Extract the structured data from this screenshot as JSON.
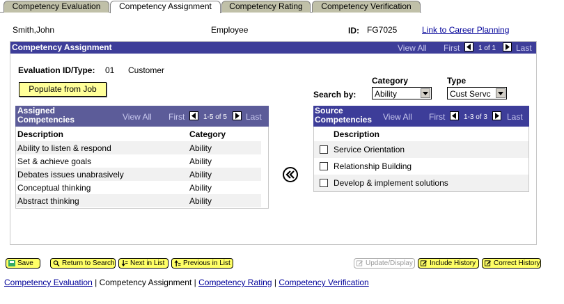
{
  "tabs": [
    {
      "label": "Competency Evaluation",
      "active": false
    },
    {
      "label": "Competency Assignment",
      "active": true
    },
    {
      "label": "Competency Rating",
      "active": false
    },
    {
      "label": "Competency Verification",
      "active": false
    }
  ],
  "header": {
    "name": "Smith,John",
    "role": "Employee",
    "id_label": "ID:",
    "id_value": "FG7025",
    "career_link": "Link to Career Planning"
  },
  "panel": {
    "title": "Competency Assignment",
    "view_all": "View All",
    "first": "First",
    "count": "1 of 1",
    "last": "Last"
  },
  "evaluation": {
    "label": "Evaluation ID/Type:",
    "id": "01",
    "type": "Customer"
  },
  "populate_button": "Populate from Job",
  "search": {
    "label": "Search by:",
    "category_label": "Category",
    "category_value": "Ability",
    "type_label": "Type",
    "type_value": "Cust Servc"
  },
  "assigned": {
    "title_line1": "Assigned",
    "title_line2": "Competencies",
    "view_all": "View All",
    "first": "First",
    "count": "1-5 of 5",
    "last": "Last",
    "col_description": "Description",
    "col_category": "Category",
    "rows": [
      {
        "description": "Ability to listen & respond",
        "category": "Ability"
      },
      {
        "description": "Set & achieve goals",
        "category": "Ability"
      },
      {
        "description": "Debates issues unabrasively",
        "category": "Ability"
      },
      {
        "description": "Conceptual thinking",
        "category": "Ability"
      },
      {
        "description": "Abstract thinking",
        "category": "Ability"
      }
    ]
  },
  "source": {
    "title_line1": "Source",
    "title_line2": "Competencies",
    "view_all": "View All",
    "first": "First",
    "count": "1-3 of 3",
    "last": "Last",
    "col_description": "Description",
    "rows": [
      {
        "description": "Service Orientation",
        "checked": false
      },
      {
        "description": "Relationship Building",
        "checked": false
      },
      {
        "description": "Develop & implement solutions",
        "checked": false
      }
    ]
  },
  "move_icon": "double-chevron-left-icon",
  "toolbar": {
    "save": "Save",
    "return_to_search": "Return to Search",
    "next_in_list": "Next in List",
    "previous_in_list": "Previous in List",
    "update_display": "Update/Display",
    "include_history": "Include History",
    "correct_history": "Correct History"
  },
  "footer_links": [
    "Competency Evaluation",
    "Competency Assignment",
    "Competency Rating",
    "Competency Verification"
  ],
  "footer_separator": "|",
  "colors": {
    "bar": "#3d3d99",
    "tab": "#c0c0a8",
    "button_yellow": "#ffff99",
    "link": "#000099"
  }
}
